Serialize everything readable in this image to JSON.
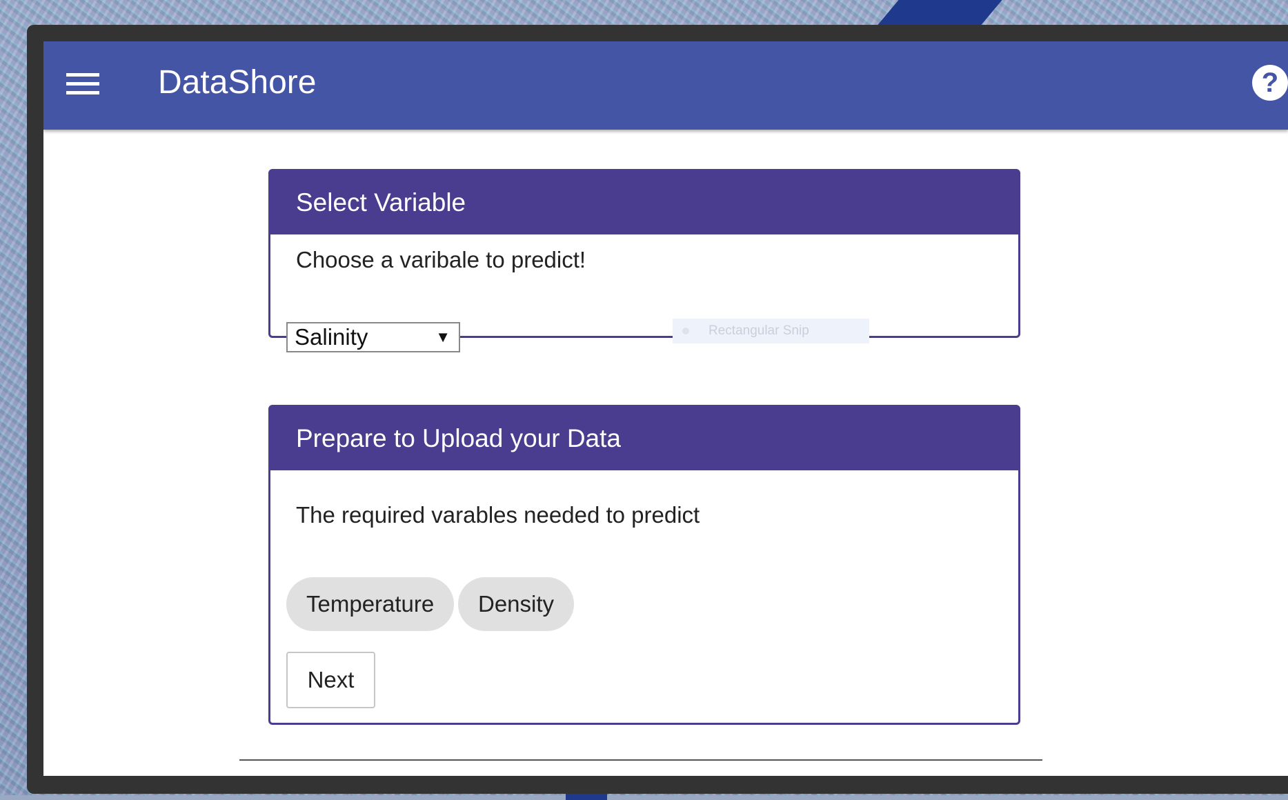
{
  "app": {
    "title": "DataShore",
    "help_label": "?"
  },
  "select_variable_card": {
    "title": "Select Variable",
    "prompt": "Choose a varibale to predict!",
    "selected_value": "Salinity",
    "dropdown_arrow": "▼"
  },
  "snip_overlay": {
    "label": "Rectangular Snip"
  },
  "upload_card": {
    "title": "Prepare to Upload your Data",
    "description": "The required varables needed to predict",
    "chips": [
      "Temperature",
      "Density"
    ],
    "next_label": "Next"
  },
  "colors": {
    "appbar": "#4555a5",
    "card_header": "#4a3d8f",
    "chip_bg": "#e0e0e0"
  },
  "icons": {
    "menu": "hamburger-menu-icon",
    "help": "help-circle-icon"
  }
}
